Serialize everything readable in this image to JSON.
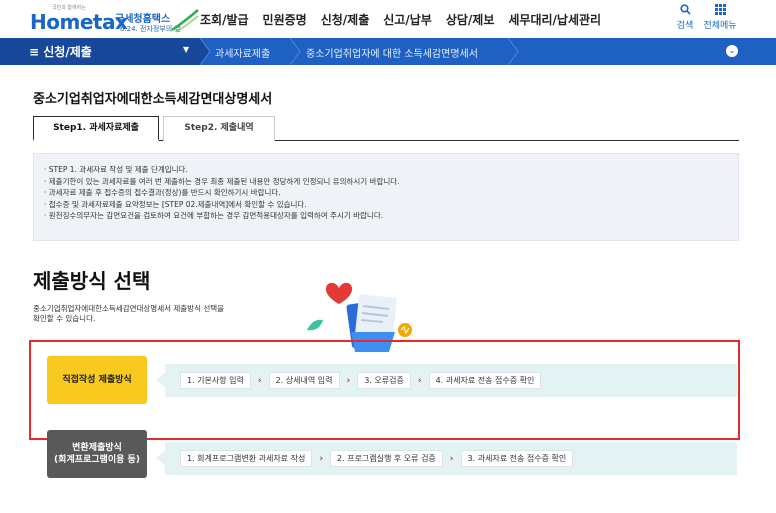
{
  "header": {
    "logo_en": "Hometax",
    "logo_kr": "국세청홈택스",
    "logo_sub": "6.24. 전자정부의 날",
    "logo_tiny": "국민과 함께하는",
    "nav": [
      "조회/발급",
      "민원증명",
      "신청/제출",
      "신고/납부",
      "상담/제보",
      "세무대리/납세관리"
    ],
    "search_label": "검색",
    "menu_label": "전체메뉴"
  },
  "breadcrumb": {
    "menu_label": "≡  신청/제출",
    "items": [
      "과세자료제출",
      "중소기업취업자에 대한 소득세감면명세서"
    ]
  },
  "page": {
    "title": "중소기업취업자에대한소득세감면대상명세서",
    "tabs": [
      "Step1. 과세자료제출",
      "Step2. 제출내역"
    ],
    "notice": [
      "STEP 1. 과세자료 작성 및 제출 단계입니다.",
      "제출기한이 있는 과세자료를 여러 번 제출하는 경우 최종 제출된 내용만 정당하게 인정되니 유의하시기 바랍니다.",
      "과세자료 제출 후 접수증의 접수결과(정상)를 반드시 확인하기시 바랍니다.",
      "접수증 및 과세자료제출 요약정보는 [STEP 02.제출내역]에서 확인할 수 있습니다.",
      "원천징수의무자는 감면요건을 검토하여 요건에 부합하는 경우 감면적용대상자를 입력하여 주시기 바랍니다."
    ],
    "section_title": "제출방식 선택",
    "section_desc_1": "중소기업취업자에대한소득세감면대상명세서 제출방식 선택을",
    "section_desc_2": "확인할 수 있습니다."
  },
  "methods": [
    {
      "label_1": "직접작성 제출방식",
      "label_2": "",
      "steps": [
        "1. 기본사항 입력",
        "2. 상세내역 입력",
        "3. 오류검증",
        "4. 과세자료 전송 접수증 확인"
      ]
    },
    {
      "label_1": "변환제출방식",
      "label_2": "(회계프로그램이용 등)",
      "steps": [
        "1. 회계프로그램변환 과세자료 작성",
        "2. 프로그램실행 후 오류 검증",
        "3. 과세자료 전송 접수증 확인"
      ]
    }
  ],
  "step_separator": "›",
  "colors": {
    "brand_blue": "#1e61c2",
    "dark_blue": "#17489a",
    "method1_bg": "#f8c91f",
    "method2_bg": "#595959",
    "highlight_red": "#e52a2a",
    "step_bg": "#e3f3f3"
  }
}
